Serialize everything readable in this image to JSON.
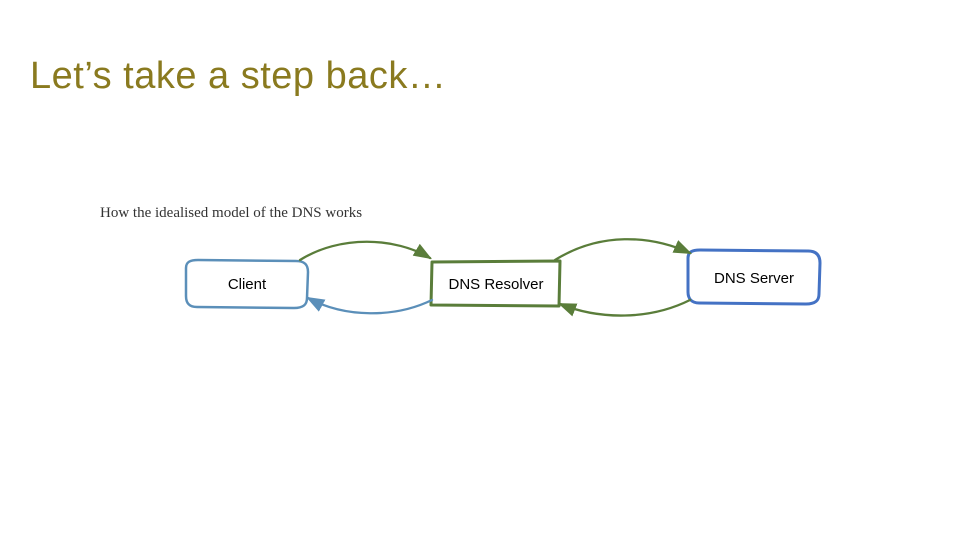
{
  "title": "Let’s take a step back…",
  "subtitle": "How the idealised model of the DNS works",
  "diagram": {
    "nodes": {
      "client": {
        "label": "Client"
      },
      "resolver": {
        "label": "DNS Resolver"
      },
      "server": {
        "label": "DNS Server"
      }
    },
    "colors": {
      "client_outline": "#5b8fb9",
      "resolver_outline": "#5a7d3a",
      "server_outline": "#4472c4",
      "arrow": "#5a7d3a"
    }
  }
}
